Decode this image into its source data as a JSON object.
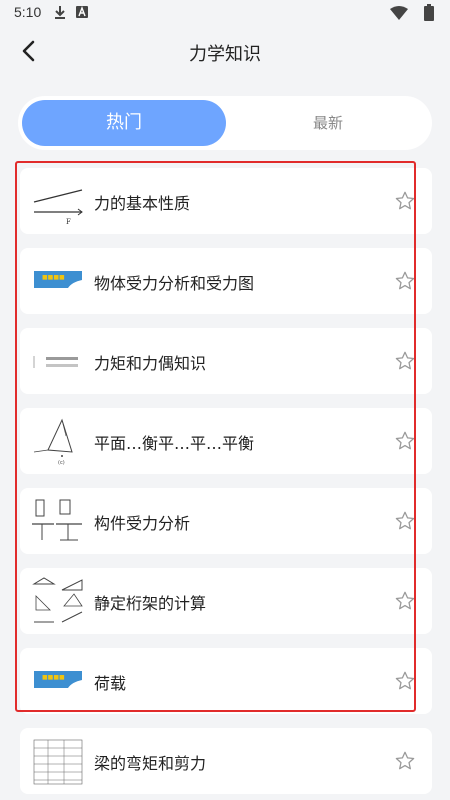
{
  "status_bar": {
    "time": "5:10"
  },
  "header": {
    "title": "力学知识"
  },
  "tabs": [
    {
      "label": "热门",
      "active": true
    },
    {
      "label": "最新",
      "active": false
    }
  ],
  "accent_color": "#6ea5ff",
  "highlight_color": "#e12b2b",
  "items": [
    {
      "title": "力的基本性质",
      "thumb_icon": "force-vector-diagram"
    },
    {
      "title": "物体受力分析和受力图",
      "thumb_icon": "beam-diagram"
    },
    {
      "title": "力矩和力偶知识",
      "thumb_icon": "lines-diagram"
    },
    {
      "title": "平面…衡平…平…平衡",
      "thumb_icon": "truss-plane-diagram"
    },
    {
      "title": "构件受力分析",
      "thumb_icon": "component-diagram"
    },
    {
      "title": "静定桁架的计算",
      "thumb_icon": "truss-diagram"
    },
    {
      "title": "荷载",
      "thumb_icon": "beam-diagram"
    },
    {
      "title": "梁的弯矩和剪力",
      "thumb_icon": "table-diagram"
    }
  ]
}
